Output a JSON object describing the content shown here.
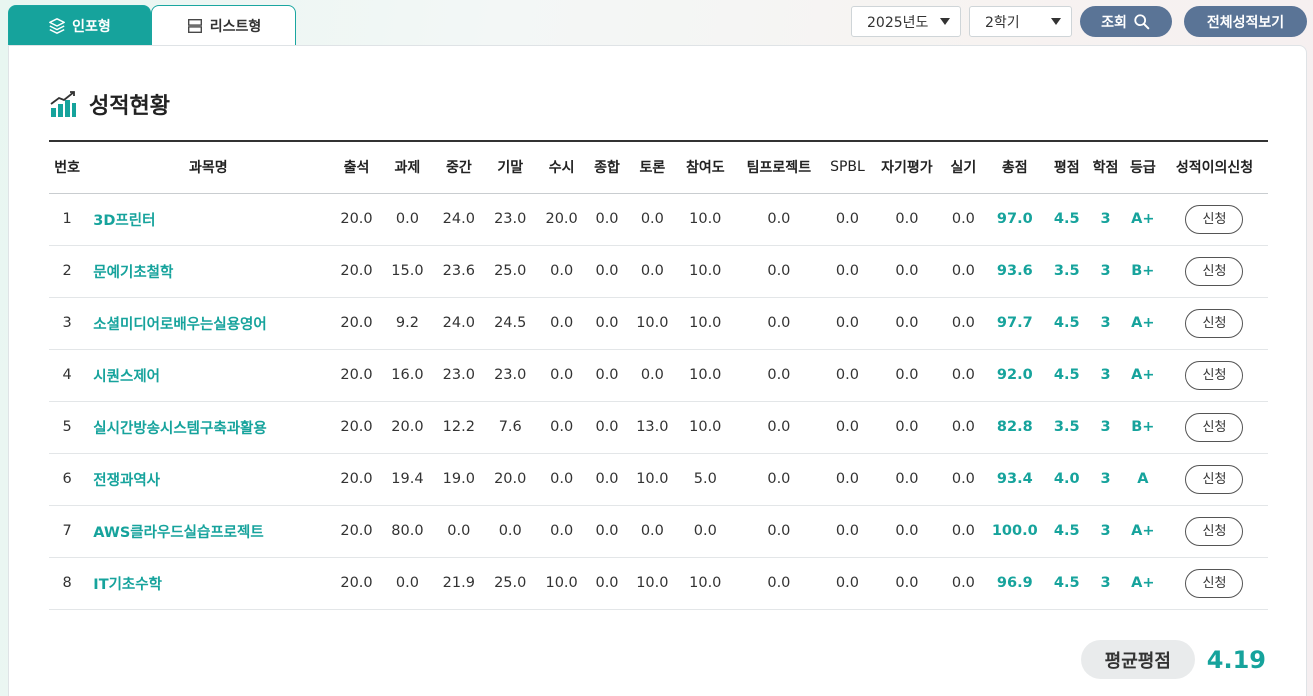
{
  "tabs": {
    "info": "인포형",
    "list": "리스트형"
  },
  "filters": {
    "year": "2025년도",
    "term": "2학기",
    "search_label": "조회",
    "all_grades_label": "전체성적보기"
  },
  "section_title": "성적현황",
  "table": {
    "headers": [
      "번호",
      "과목명",
      "출석",
      "과제",
      "중간",
      "기말",
      "수시",
      "종합",
      "토론",
      "참여도",
      "팀프로젝트",
      "SPBL",
      "자기평가",
      "실기",
      "총점",
      "평점",
      "학점",
      "등급",
      "성적이의신청"
    ],
    "rows": [
      [
        "1",
        "3D프린터",
        "20.0",
        "0.0",
        "24.0",
        "23.0",
        "20.0",
        "0.0",
        "0.0",
        "10.0",
        "0.0",
        "0.0",
        "0.0",
        "0.0",
        "97.0",
        "4.5",
        "3",
        "A+",
        "신청"
      ],
      [
        "2",
        "문예기초철학",
        "20.0",
        "15.0",
        "23.6",
        "25.0",
        "0.0",
        "0.0",
        "0.0",
        "10.0",
        "0.0",
        "0.0",
        "0.0",
        "0.0",
        "93.6",
        "3.5",
        "3",
        "B+",
        "신청"
      ],
      [
        "3",
        "소셜미디어로배우는실용영어",
        "20.0",
        "9.2",
        "24.0",
        "24.5",
        "0.0",
        "0.0",
        "10.0",
        "10.0",
        "0.0",
        "0.0",
        "0.0",
        "0.0",
        "97.7",
        "4.5",
        "3",
        "A+",
        "신청"
      ],
      [
        "4",
        "시퀀스제어",
        "20.0",
        "16.0",
        "23.0",
        "23.0",
        "0.0",
        "0.0",
        "0.0",
        "10.0",
        "0.0",
        "0.0",
        "0.0",
        "0.0",
        "92.0",
        "4.5",
        "3",
        "A+",
        "신청"
      ],
      [
        "5",
        "실시간방송시스템구축과활용",
        "20.0",
        "20.0",
        "12.2",
        "7.6",
        "0.0",
        "0.0",
        "13.0",
        "10.0",
        "0.0",
        "0.0",
        "0.0",
        "0.0",
        "82.8",
        "3.5",
        "3",
        "B+",
        "신청"
      ],
      [
        "6",
        "전쟁과역사",
        "20.0",
        "19.4",
        "19.0",
        "20.0",
        "0.0",
        "0.0",
        "10.0",
        "5.0",
        "0.0",
        "0.0",
        "0.0",
        "0.0",
        "93.4",
        "4.0",
        "3",
        "A",
        "신청"
      ],
      [
        "7",
        "AWS클라우드실습프로젝트",
        "20.0",
        "80.0",
        "0.0",
        "0.0",
        "0.0",
        "0.0",
        "0.0",
        "0.0",
        "0.0",
        "0.0",
        "0.0",
        "0.0",
        "100.0",
        "4.5",
        "3",
        "A+",
        "신청"
      ],
      [
        "8",
        "IT기초수학",
        "20.0",
        "0.0",
        "21.9",
        "25.0",
        "10.0",
        "0.0",
        "10.0",
        "10.0",
        "0.0",
        "0.0",
        "0.0",
        "0.0",
        "96.9",
        "4.5",
        "3",
        "A+",
        "신청"
      ]
    ]
  },
  "average": {
    "label": "평균평점",
    "value": "4.19"
  },
  "colors": {
    "accent": "#16a39c",
    "button": "#5a7496"
  }
}
